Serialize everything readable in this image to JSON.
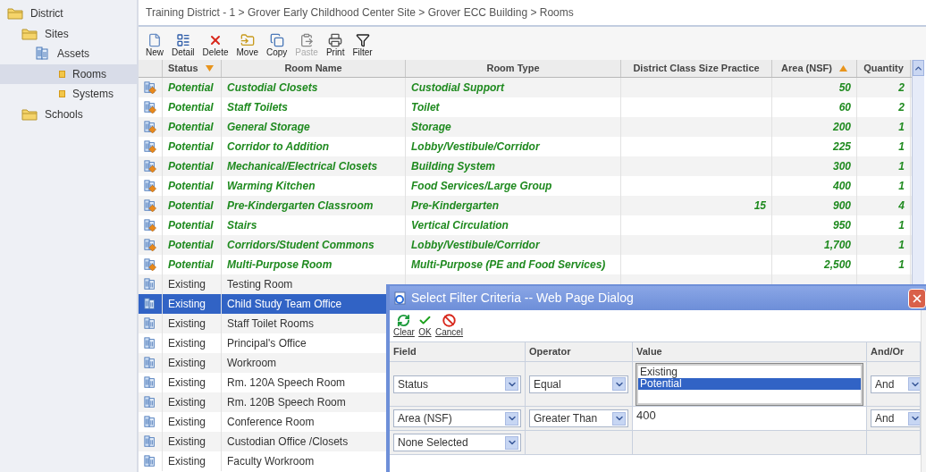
{
  "sidebar": {
    "items": [
      {
        "label": "District",
        "kind": "folder",
        "selected": false,
        "children": [
          {
            "label": "Sites",
            "kind": "folder",
            "selected": false,
            "children": [
              {
                "label": "Assets",
                "kind": "building",
                "selected": false,
                "children": [
                  {
                    "label": "Rooms",
                    "kind": "leaf",
                    "selected": true
                  },
                  {
                    "label": "Systems",
                    "kind": "leaf",
                    "selected": false
                  }
                ]
              }
            ]
          },
          {
            "label": "Schools",
            "kind": "folder",
            "selected": false
          }
        ]
      }
    ]
  },
  "breadcrumb": "Training District - 1 > Grover Early Childhood Center Site > Grover ECC Building > Rooms",
  "toolbar": [
    {
      "label": "New",
      "kind": "new",
      "disabled": false
    },
    {
      "label": "Detail",
      "kind": "detail",
      "disabled": false
    },
    {
      "label": "Delete",
      "kind": "delete",
      "disabled": false
    },
    {
      "label": "Move",
      "kind": "move",
      "disabled": false
    },
    {
      "label": "Copy",
      "kind": "copy",
      "disabled": false
    },
    {
      "label": "Paste",
      "kind": "paste",
      "disabled": true
    },
    {
      "label": "Print",
      "kind": "print",
      "disabled": false
    },
    {
      "label": "Filter",
      "kind": "filter",
      "disabled": false
    }
  ],
  "table": {
    "columns": [
      {
        "label": "Status",
        "sorted": true,
        "descending": true
      },
      {
        "label": "Room Name",
        "sorted": false
      },
      {
        "label": "Room Type",
        "sorted": false
      },
      {
        "label": "District Class Size Practice",
        "sorted": false
      },
      {
        "label": "Area (NSF)",
        "sorted": true,
        "descending": false
      },
      {
        "label": "Quantity",
        "sorted": false
      }
    ],
    "rows": [
      {
        "kind": "potential",
        "selected": false,
        "status": "Potential",
        "room_name": "Custodial Closets",
        "room_type": "Custodial Support",
        "area": "50",
        "quantity": "2"
      },
      {
        "kind": "potential",
        "selected": false,
        "status": "Potential",
        "room_name": "Staff Toilets",
        "room_type": "Toilet",
        "area": "60",
        "quantity": "2"
      },
      {
        "kind": "potential",
        "selected": false,
        "status": "Potential",
        "room_name": "General Storage",
        "room_type": "Storage",
        "area": "200",
        "quantity": "1"
      },
      {
        "kind": "potential",
        "selected": false,
        "status": "Potential",
        "room_name": "Corridor to Addition",
        "room_type": "Lobby/Vestibule/Corridor",
        "area": "225",
        "quantity": "1"
      },
      {
        "kind": "potential",
        "selected": false,
        "status": "Potential",
        "room_name": "Mechanical/Electrical Closets",
        "room_type": "Building System",
        "area": "300",
        "quantity": "1"
      },
      {
        "kind": "potential",
        "selected": false,
        "status": "Potential",
        "room_name": "Warming Kitchen",
        "room_type": "Food Services/Large Group",
        "area": "400",
        "quantity": "1"
      },
      {
        "kind": "potential",
        "selected": false,
        "status": "Potential",
        "room_name": "Pre-Kindergarten Classroom",
        "room_type": "Pre-Kindergarten",
        "class_size": "15",
        "area": "900",
        "quantity": "4"
      },
      {
        "kind": "potential",
        "selected": false,
        "status": "Potential",
        "room_name": "Stairs",
        "room_type": "Vertical Circulation",
        "area": "950",
        "quantity": "1"
      },
      {
        "kind": "potential",
        "selected": false,
        "status": "Potential",
        "room_name": "Corridors/Student Commons",
        "room_type": "Lobby/Vestibule/Corridor",
        "area": "1,700",
        "quantity": "1"
      },
      {
        "kind": "potential",
        "selected": false,
        "status": "Potential",
        "room_name": "Multi-Purpose Room",
        "room_type": "Multi-Purpose (PE and Food Services)",
        "area": "2,500",
        "quantity": "1"
      },
      {
        "kind": "existing",
        "selected": false,
        "status": "Existing",
        "room_name": "Testing Room"
      },
      {
        "kind": "existing",
        "selected": true,
        "status": "Existing",
        "room_name": "Child Study Team Office"
      },
      {
        "kind": "existing",
        "selected": false,
        "status": "Existing",
        "room_name": "Staff Toilet Rooms"
      },
      {
        "kind": "existing",
        "selected": false,
        "status": "Existing",
        "room_name": "Principal's Office"
      },
      {
        "kind": "existing",
        "selected": false,
        "status": "Existing",
        "room_name": "Workroom"
      },
      {
        "kind": "existing",
        "selected": false,
        "status": "Existing",
        "room_name": "Rm. 120A Speech Room"
      },
      {
        "kind": "existing",
        "selected": false,
        "status": "Existing",
        "room_name": "Rm. 120B Speech Room"
      },
      {
        "kind": "existing",
        "selected": false,
        "status": "Existing",
        "room_name": "Conference Room"
      },
      {
        "kind": "existing",
        "selected": false,
        "status": "Existing",
        "room_name": "Custodian Office /Closets"
      },
      {
        "kind": "existing",
        "selected": false,
        "status": "Existing",
        "room_name": "Faculty Workroom"
      }
    ]
  },
  "dialog": {
    "title": "Select Filter Criteria -- Web Page Dialog",
    "toolbar": [
      {
        "label": "Clear",
        "kind": "clear"
      },
      {
        "label": "OK",
        "kind": "ok"
      },
      {
        "label": "Cancel",
        "kind": "cancel"
      }
    ],
    "columns": [
      "Field",
      "Operator",
      "Value",
      "And/Or"
    ],
    "rows": [
      {
        "kind": "list",
        "field": "Status",
        "operator": "Equal",
        "options": [
          {
            "label": "Existing",
            "selected": false
          },
          {
            "label": "Potential",
            "selected": true
          }
        ],
        "and_or": "And"
      },
      {
        "kind": "text",
        "field": "Area (NSF)",
        "operator": "Greater Than",
        "value": "400",
        "and_or": "And"
      },
      {
        "kind": "empty",
        "field": "None Selected"
      }
    ]
  }
}
